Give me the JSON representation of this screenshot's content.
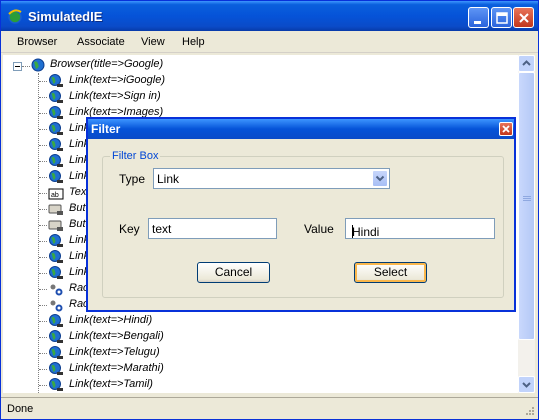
{
  "window": {
    "title": "SimulatedIE"
  },
  "menu": [
    "Browser",
    "Associate",
    "View",
    "Help"
  ],
  "tree": {
    "root": "Browser(title=>Google)",
    "items": [
      {
        "label": "Link(text=>iGoogle)",
        "icon": "globe-link-icon"
      },
      {
        "label": "Link(text=>Sign in)",
        "icon": "globe-link-icon"
      },
      {
        "label": "Link(text=>Images)",
        "icon": "globe-link-icon"
      },
      {
        "label": "Link",
        "icon": "globe-link-icon"
      },
      {
        "label": "Link",
        "icon": "globe-link-icon"
      },
      {
        "label": "Link",
        "icon": "globe-link-icon"
      },
      {
        "label": "Link",
        "icon": "globe-link-icon"
      },
      {
        "label": "Tex",
        "icon": "textbox-icon"
      },
      {
        "label": "Butt",
        "icon": "button-icon"
      },
      {
        "label": "Butt",
        "icon": "button-icon"
      },
      {
        "label": "Link",
        "icon": "globe-link-icon"
      },
      {
        "label": "Link",
        "icon": "globe-link-icon"
      },
      {
        "label": "Link",
        "icon": "globe-link-icon"
      },
      {
        "label": "Rac",
        "icon": "radio-icon"
      },
      {
        "label": "Rac",
        "icon": "radio-icon"
      },
      {
        "label": "Link(text=>Hindi)",
        "icon": "globe-link-icon"
      },
      {
        "label": "Link(text=>Bengali)",
        "icon": "globe-link-icon"
      },
      {
        "label": "Link(text=>Telugu)",
        "icon": "globe-link-icon"
      },
      {
        "label": "Link(text=>Marathi)",
        "icon": "globe-link-icon"
      },
      {
        "label": "Link(text=>Tamil)",
        "icon": "globe-link-icon"
      }
    ]
  },
  "status": "Done",
  "dialog": {
    "title": "Filter",
    "group_title": "Filter Box",
    "type_label": "Type",
    "type_value": "Link",
    "key_label": "Key",
    "key_value": "text",
    "value_label": "Value",
    "value_value": "Hindi",
    "cancel_label": "Cancel",
    "select_label": "Select"
  },
  "colors": {
    "titlebar": "#0553d8",
    "window_bg": "#ece9d8",
    "group_title": "#0046d5"
  }
}
